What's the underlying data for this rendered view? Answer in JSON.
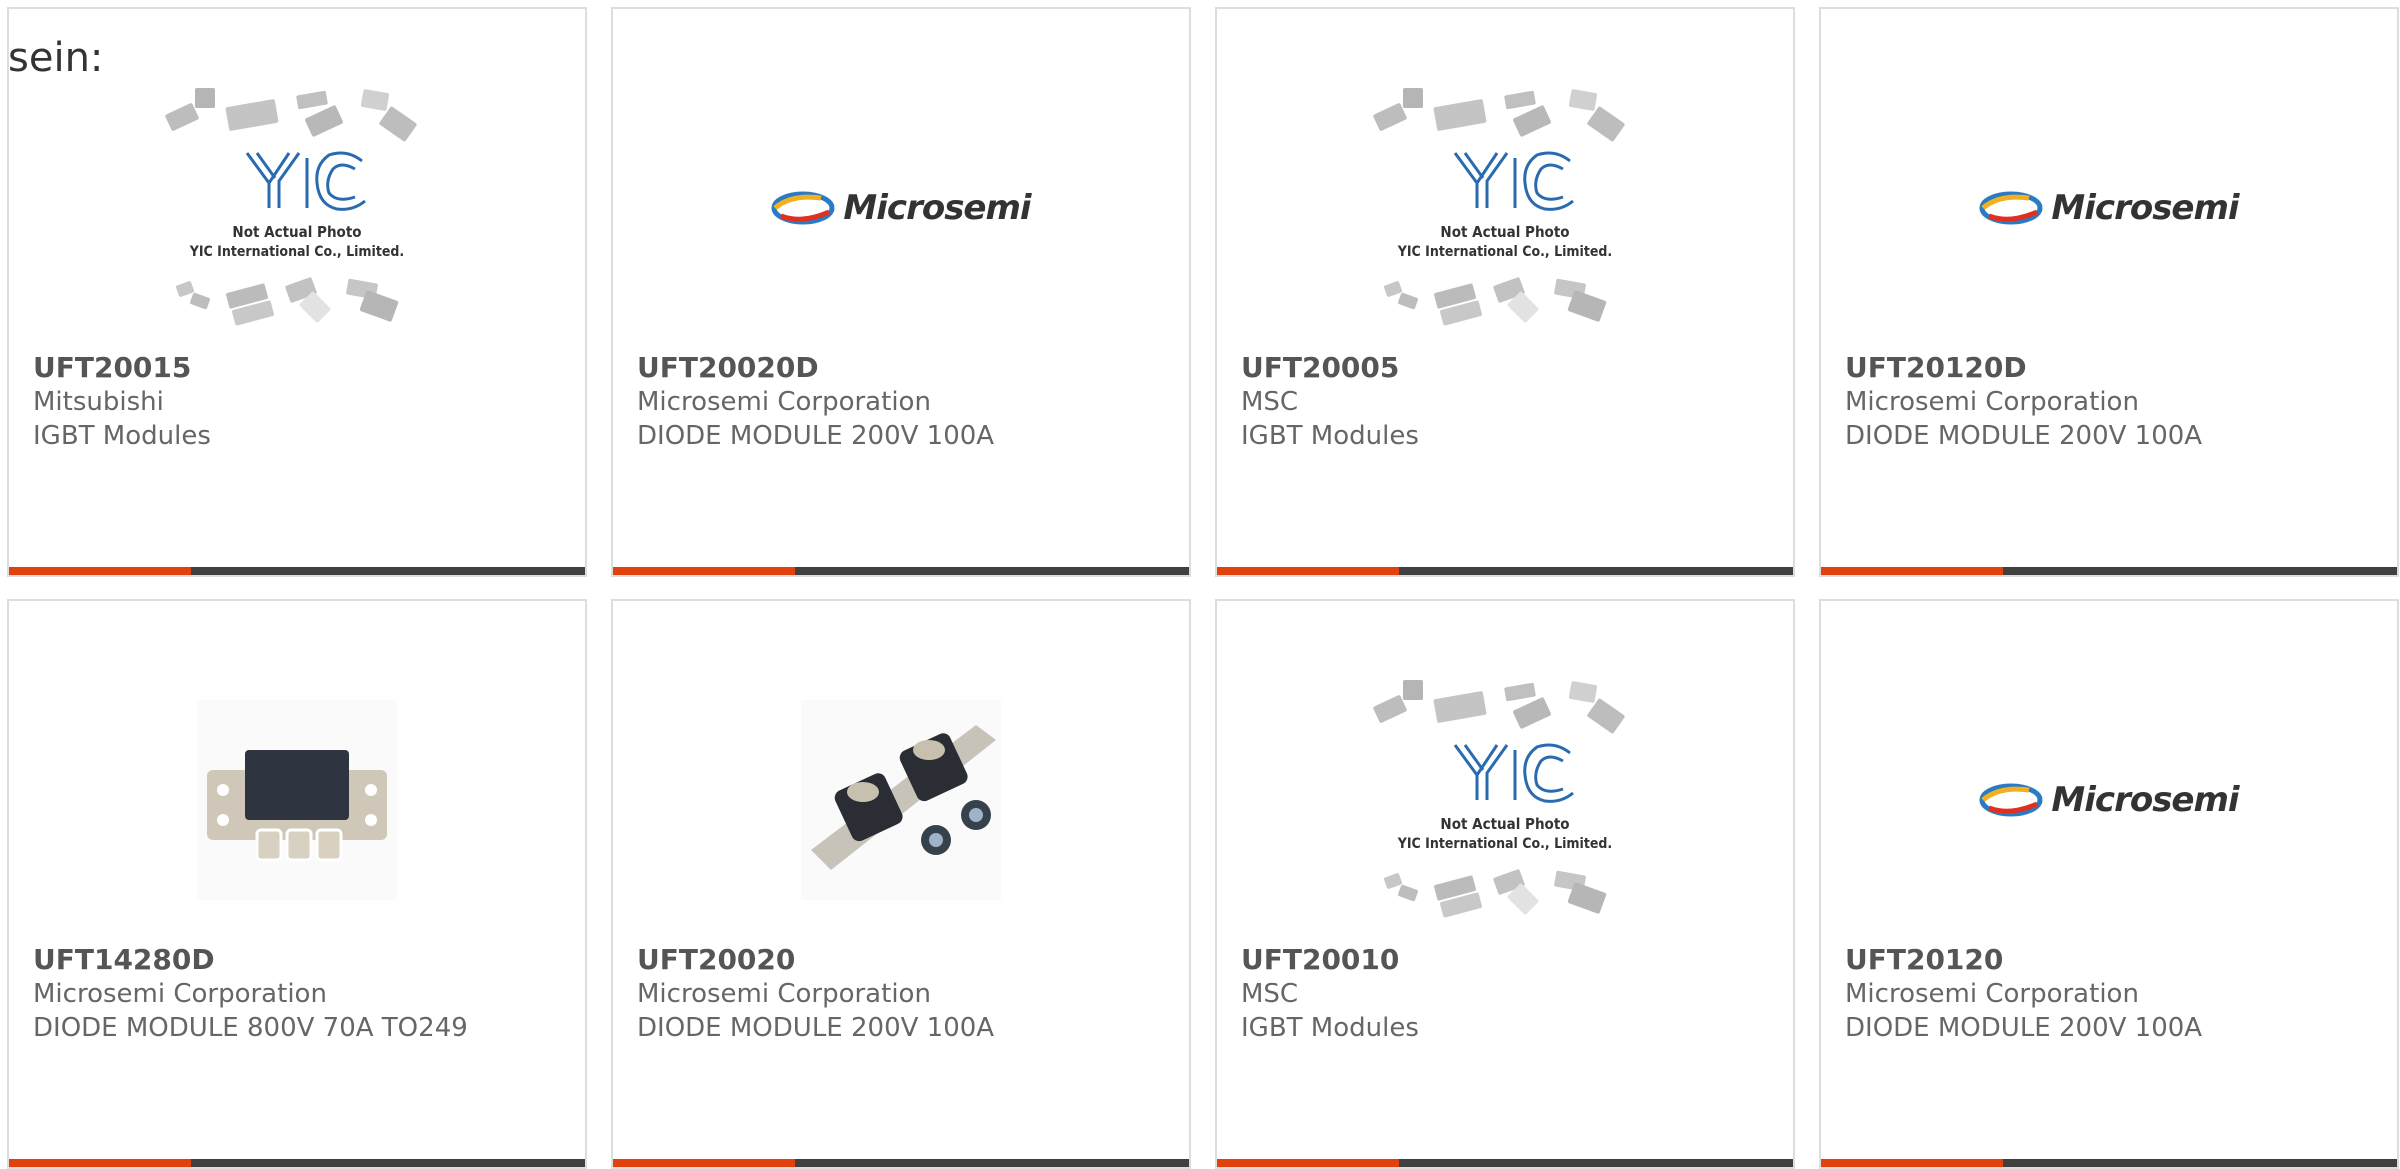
{
  "intro_text": "sein:",
  "placeholder_logo": {
    "brand": "YIC",
    "line1": "Not Actual Photo",
    "line2": "YIC International Co., Limited."
  },
  "microsemi_logo_text": "Microsemi",
  "colors": {
    "accent": "#e0410f",
    "bar": "#404040",
    "border": "#dddddd"
  },
  "products": [
    {
      "part": "UFT20015",
      "maker": "Mitsubishi",
      "desc": "IGBT Modules",
      "image": "placeholder"
    },
    {
      "part": "UFT20020D",
      "maker": "Microsemi Corporation",
      "desc": "DIODE MODULE 200V 100A",
      "image": "microsemi-logo"
    },
    {
      "part": "UFT20005",
      "maker": "MSC",
      "desc": "IGBT Modules",
      "image": "placeholder"
    },
    {
      "part": "UFT20120D",
      "maker": "Microsemi Corporation",
      "desc": "DIODE MODULE 200V 100A",
      "image": "microsemi-logo"
    },
    {
      "part": "UFT14280D",
      "maker": "Microsemi Corporation",
      "desc": "DIODE MODULE 800V 70A TO249",
      "image": "module-photo"
    },
    {
      "part": "UFT20020",
      "maker": "Microsemi Corporation",
      "desc": "DIODE MODULE 200V 100A",
      "image": "diode-photo"
    },
    {
      "part": "UFT20010",
      "maker": "MSC",
      "desc": "IGBT Modules",
      "image": "placeholder"
    },
    {
      "part": "UFT20120",
      "maker": "Microsemi Corporation",
      "desc": "DIODE MODULE 200V 100A",
      "image": "microsemi-logo"
    }
  ]
}
